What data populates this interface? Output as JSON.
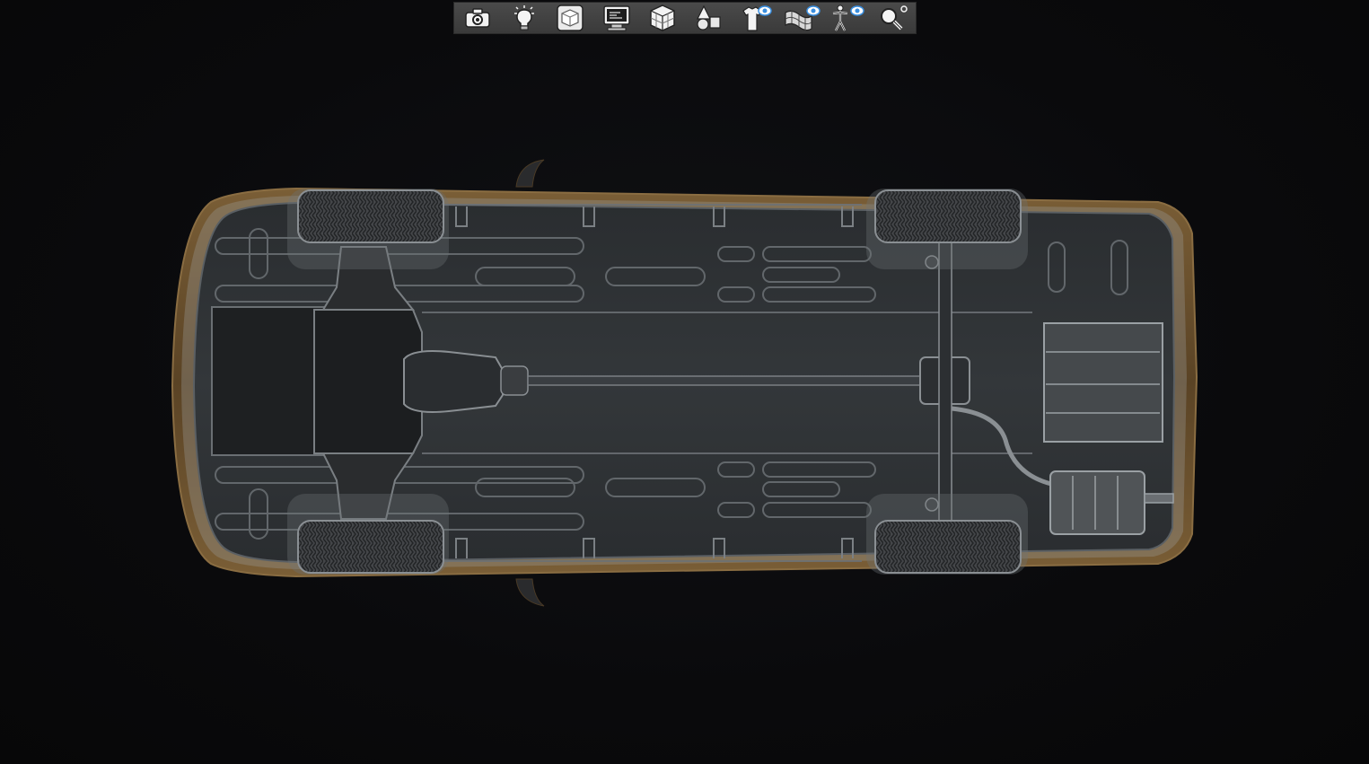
{
  "viewport": {
    "background": "#0b0b0d",
    "model": "car-underside"
  },
  "toolbar": {
    "buttons": [
      {
        "icon": "camera-icon"
      },
      {
        "icon": "lightbulb-icon"
      },
      {
        "icon": "solid-cube-icon"
      },
      {
        "icon": "monitor-icon"
      },
      {
        "icon": "wireframe-cube-icon"
      },
      {
        "icon": "primitives-icon"
      },
      {
        "icon": "shirt-visibility-icon"
      },
      {
        "icon": "mesh-visibility-icon"
      },
      {
        "icon": "skeleton-visibility-icon"
      },
      {
        "icon": "zoom-icon"
      }
    ]
  },
  "colors": {
    "toolbar_bg": "#444444",
    "eye_accent": "#3a8fe0",
    "car_body": "#6b5230",
    "chassis": "#2b2e31",
    "chrome": "#9aa0a4"
  }
}
